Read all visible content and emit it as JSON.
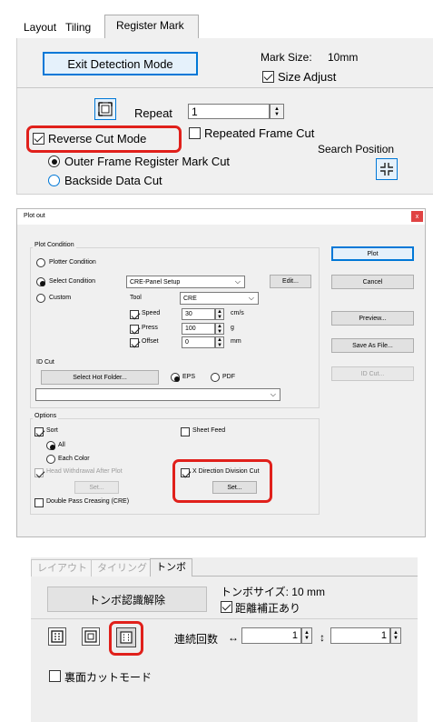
{
  "panel1": {
    "tabs": [
      "Layout",
      "Tiling",
      "Register Mark"
    ],
    "exit_detection_label": "Exit Detection Mode",
    "mark_size_label": "Mark Size:",
    "mark_size_value": "10mm",
    "size_adjust_label": "Size Adjust",
    "repeat_label": "Repeat",
    "repeat_value": "1",
    "reverse_cut_label": "Reverse Cut Mode",
    "repeated_frame_label": "Repeated Frame Cut",
    "search_position_label": "Search Position",
    "outer_frame_label": "Outer Frame Register Mark Cut",
    "backside_label": "Backside Data Cut"
  },
  "dialog": {
    "title": "Plot out",
    "close_glyph": "x",
    "plot_condition_label": "Plot Condition",
    "plotter_condition_label": "Plotter Condition",
    "select_condition_label": "Select Condition",
    "select_condition_value": "CRE-Panel Setup",
    "edit_label": "Edit...",
    "custom_label": "Custom",
    "tool_label": "Tool",
    "tool_value": "CRE",
    "speed_label": "Speed",
    "speed_value": "30",
    "speed_unit": "cm/s",
    "press_label": "Press",
    "press_value": "100",
    "press_unit": "g",
    "offset_label": "Offset",
    "offset_value": "0",
    "offset_unit": "mm",
    "id_cut_label": "ID Cut",
    "hot_folder_label": "Select Hot Folder...",
    "eps_label": "EPS",
    "pdf_label": "PDF",
    "options_label": "Options",
    "sort_label": "Sort",
    "all_label": "All",
    "each_color_label": "Each Color",
    "head_withdrawal_label": "Head Withdrawal After Plot",
    "set_label": "Set...",
    "double_pass_label": "Double Pass Creasing (CRE)",
    "sheet_feed_label": "Sheet Feed",
    "x_division_label": "X Direction Division Cut",
    "plot_label": "Plot",
    "cancel_label": "Cancel",
    "preview_label": "Preview...",
    "save_as_label": "Save As File...",
    "id_cut_btn_label": "ID Cut..."
  },
  "panel3": {
    "tabs": [
      "レイアウト",
      "タイリング",
      "トンボ"
    ],
    "cancel_detection_label": "トンボ認識解除",
    "mark_size_label": "トンボサイズ: 10 mm",
    "distance_label": "距離補正あり",
    "repeat_label": "連続回数",
    "h_arrow": "↔",
    "h_value": "1",
    "v_arrow": "↕",
    "v_value": "1",
    "reverse_label": "裏面カットモード"
  },
  "colors": {
    "highlight_red": "#e0201b",
    "selection_blue": "#0078d7",
    "panel_bg": "#f0f0f0",
    "dialog_close_bg": "#e04343"
  }
}
